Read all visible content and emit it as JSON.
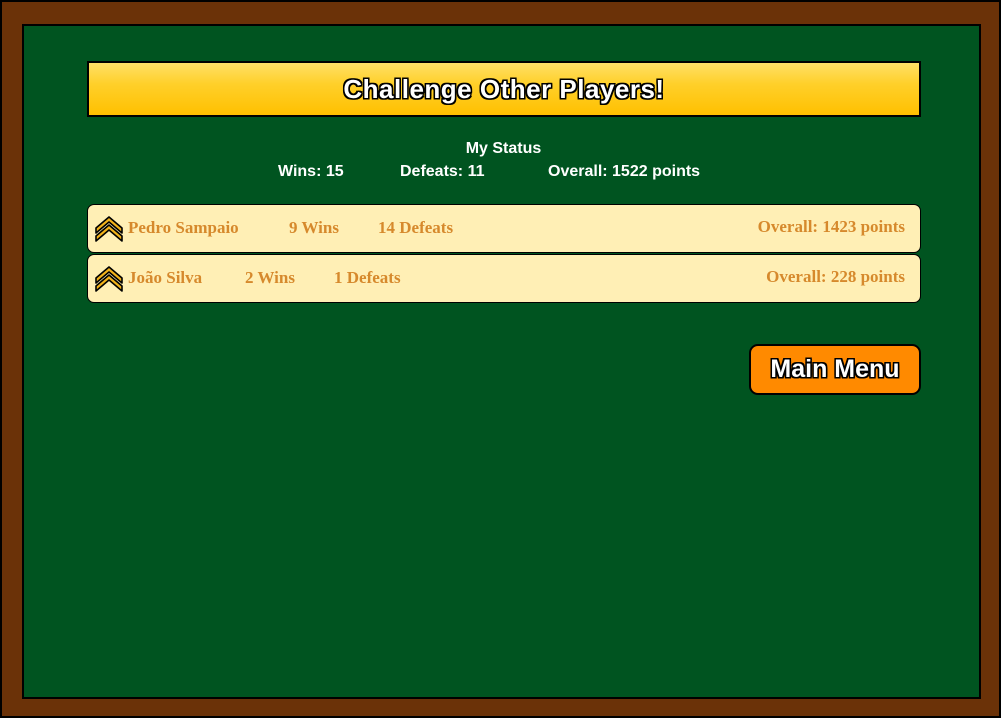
{
  "title": "Challenge Other Players!",
  "my_status": {
    "heading": "My Status",
    "wins": "Wins: 15",
    "defeats": "Defeats: 11",
    "overall": "Overall: 1522 points"
  },
  "players": [
    {
      "rank_icon": "corporal-chevron-icon",
      "name": "Pedro Sampaio",
      "wins": "9 Wins",
      "defeats": "14 Defeats",
      "overall": "Overall: 1423 points"
    },
    {
      "rank_icon": "corporal-chevron-icon",
      "name": "João Silva",
      "wins": "2 Wins",
      "defeats": "1 Defeats",
      "overall": "Overall: 228 points"
    }
  ],
  "buttons": {
    "main_menu": "Main Menu"
  },
  "colors": {
    "frame": "#6b3208",
    "board": "#005420",
    "banner": "#ffc000",
    "row_background": "#ffefb5",
    "row_text": "#d6892c",
    "button": "#ff8a00"
  }
}
